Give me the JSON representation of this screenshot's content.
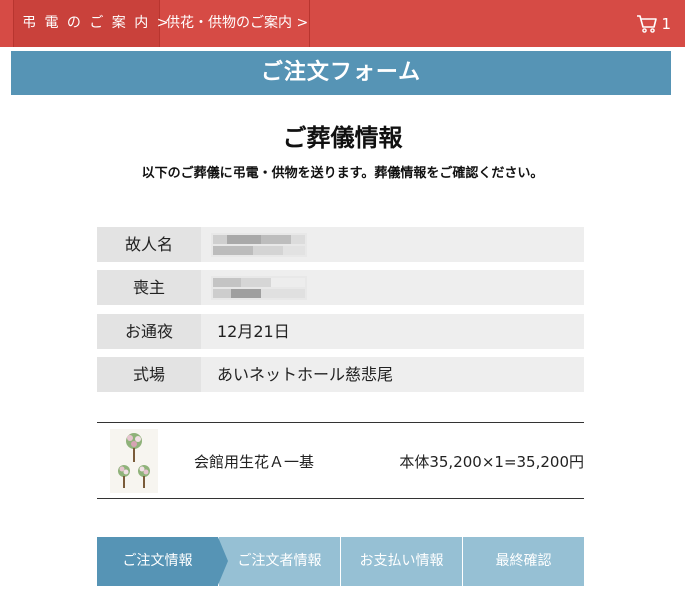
{
  "topbar": {
    "crumbs": [
      "弔 電 の ご 案 内 >",
      "供花・供物のご案内 >"
    ],
    "cart_count": "1",
    "accent": "#d64b45"
  },
  "banner": {
    "title": "ご注文フォーム",
    "color": "#5694b5"
  },
  "section": {
    "title": "ご葬儀情報",
    "subtitle": "以下のご葬儀に弔電・供物を送ります。葬儀情報をご確認ください。"
  },
  "info": [
    {
      "label": "故人名",
      "value": ""
    },
    {
      "label": "喪主",
      "value": ""
    },
    {
      "label": "お通夜",
      "value": "12月21日"
    },
    {
      "label": "式場",
      "value": "あいネットホール慈悲尾"
    }
  ],
  "order": {
    "product_name": "会館用生花Ａ一基",
    "price_text": "本体35,200×1=35,200円"
  },
  "steps": [
    {
      "label": "ご注文情報",
      "active": true
    },
    {
      "label": "ご注文者情報",
      "active": false
    },
    {
      "label": "お支払い情報",
      "active": false
    },
    {
      "label": "最終確認",
      "active": false
    }
  ]
}
